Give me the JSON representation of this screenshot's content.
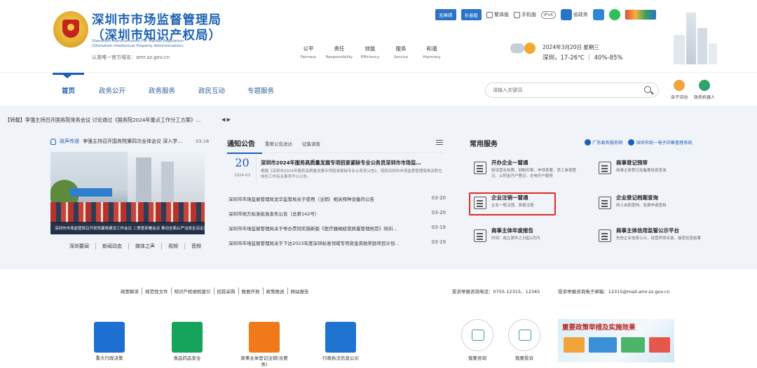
{
  "header": {
    "title_line1": "深圳市市场监督管理局",
    "title_line2": "（深圳市知识产权局）",
    "title_en_line1": "Shenzhen Administration For Market Regulation",
    "title_en_line2": "(Shenzhen Intellectual Property Administration)",
    "domain_line": "认准唯一官方域名：amr.sz.gov.cn",
    "values": [
      {
        "cn": "公平",
        "en": "Fairness"
      },
      {
        "cn": "责任",
        "en": "Responsibility"
      },
      {
        "cn": "效能",
        "en": "Efficiency"
      },
      {
        "cn": "服务",
        "en": "Service"
      },
      {
        "cn": "和谐",
        "en": "Harmony"
      }
    ],
    "top_buttons": [
      "无障碍",
      "长者版"
    ],
    "top_links": [
      "繁体版",
      "手机版",
      "IPv6",
      "省政务"
    ],
    "weather": {
      "date": "2024年3月20日 星期三",
      "temp": "深圳，17-26℃ ｜ 40%-85%"
    }
  },
  "nav": {
    "items": [
      "首页",
      "政务公开",
      "政务服务",
      "政民互动",
      "专题服务"
    ],
    "search_placeholder": "请输入关键词",
    "util": [
      "亲子活动",
      "政务机器人"
    ]
  },
  "ticker": {
    "text": "【转载】李强主持召开国务院常务会议 讨论通过《国务院2024年重点工作分工方案》…",
    "ctrl": "◀ ▶"
  },
  "notice": {
    "label": "政声传递",
    "text": "李强主持召开国务院第四次全体会议 深入学…",
    "date": "03-18"
  },
  "photo_caption": "深圳市市场监管局召开党风廉政建设工作会议 二季度部署会议 推动全面从严治党走深走实",
  "sub_tabs": [
    "深圳要闻",
    "新闻动态",
    "媒体之声",
    "视频",
    "音频"
  ],
  "announce": {
    "title": "通知公告",
    "tabs": [
      "重要公告送达",
      "征集调查"
    ],
    "feature": {
      "day": "20",
      "ym": "2024-03",
      "title": "深圳市2024年服务高质量发展专项招录紧缺专业公务员深圳市市场监…",
      "desc": "根据《深圳市2024年服务高质量发展专项招录紧缺专业公务员公告》，现就深圳市市场监督管理局相关职位体检工作有关事项予以公告。"
    },
    "news": [
      {
        "text": "深圳市市场监督管理局龙华监管局关于使用（注销）相关特种设备的公告",
        "date": "03-20"
      },
      {
        "text": "深圳市地方标准批准发布公告（总第142号）",
        "date": "03-20"
      },
      {
        "text": "深圳市市场监督管理局关于举办贯彻实施新版《医疗器械经营质量管理规范》培训…",
        "date": "03-19"
      },
      {
        "text": "深圳市市场监督管理局关于下达2023年度深圳标准领域专项资金资助奖励项目计划…",
        "date": "03-19"
      }
    ]
  },
  "services": {
    "title": "常用服务",
    "links": [
      "广东政务服务网",
      "深圳市统一电子印章管理系统"
    ],
    "items": [
      {
        "name": "开办企业一窗通",
        "desc": "新设营业执照、刻制印章、申领发票、员工参保登记、公积金开户登记、办电开户服务"
      },
      {
        "name": "商事登记预审",
        "desc": "商事主体登记及备案信息查询"
      },
      {
        "name": "企业注销一窗通",
        "desc": "企业一般注销、简易注销"
      },
      {
        "name": "企业登记档案查询",
        "desc": "网上自助查档、免费申请查档"
      },
      {
        "name": "商事主体年度报告",
        "desc": "时间：成立周年之日起2月内"
      },
      {
        "name": "商事主体信用监管公示平台",
        "desc": "失信企业信息公示、经营异常名录、抽查检查结果"
      }
    ]
  },
  "footer": {
    "links": [
      "政策解读",
      "规范性文件",
      "知识产权维权援引",
      "招投采购",
      "数据开放",
      "政策推送",
      "网站报告"
    ],
    "contact": [
      "投诉举报咨询电话：0755-12315、12345",
      "投诉举报咨询电子邮箱：12315@mail.amr.sz.gov.cn"
    ],
    "systems": [
      {
        "label": "重大行政决策",
        "color": "#1d6fd1"
      },
      {
        "label": "食品药品安全",
        "color": "#16a35a"
      },
      {
        "label": "商事主体登记注销(含要务)",
        "color": "#f07a1a"
      },
      {
        "label": "行政执法信息公示",
        "color": "#1f73cf"
      }
    ],
    "circles": [
      "我要咨询",
      "我要投诉"
    ],
    "promo_title": "重要政策举措及实施效果"
  }
}
